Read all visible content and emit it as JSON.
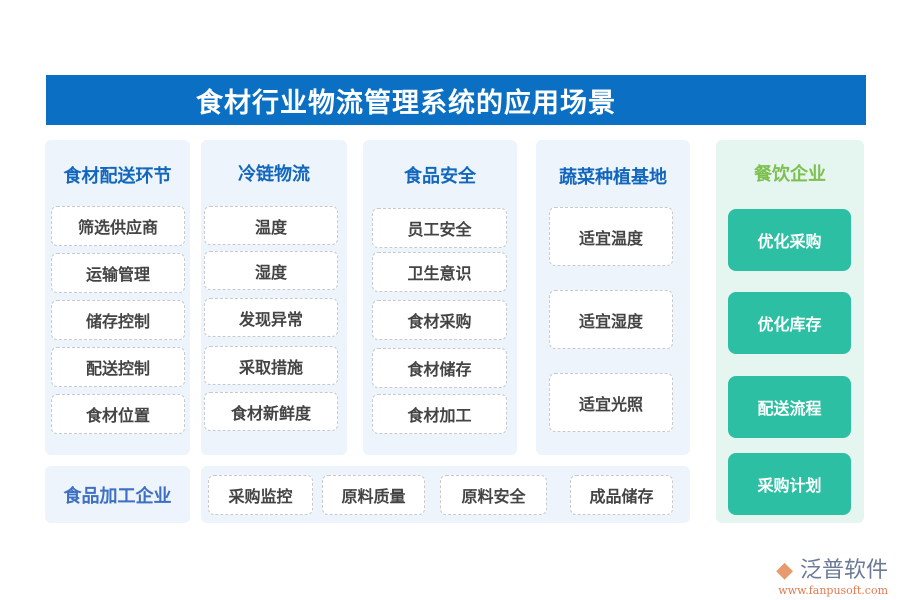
{
  "title": "食材行业物流管理系统的应用场景",
  "columns": [
    {
      "title": "食材配送环节",
      "items": [
        "筛选供应商",
        "运输管理",
        "储存控制",
        "配送控制",
        "食材位置"
      ]
    },
    {
      "title": "冷链物流",
      "items": [
        "温度",
        "湿度",
        "发现异常",
        "采取措施",
        "食材新鲜度"
      ]
    },
    {
      "title": "食品安全",
      "items": [
        "员工安全",
        "卫生意识",
        "食材采购",
        "食材储存",
        "食材加工"
      ]
    },
    {
      "title": "蔬菜种植基地",
      "items": [
        "适宜温度",
        "适宜湿度",
        "适宜光照"
      ]
    }
  ],
  "catering": {
    "title": "餐饮企业",
    "items": [
      "优化采购",
      "优化库存",
      "配送流程",
      "采购计划"
    ]
  },
  "processing": {
    "title": "食品加工企业",
    "items": [
      "采购监控",
      "原料质量",
      "原料安全",
      "成品储存"
    ]
  },
  "logo": {
    "name": "泛普软件",
    "url": "www.fanpusoft.com"
  },
  "colors": {
    "title_bar": "#0b6fc3",
    "panel": "#edf4fb",
    "teal": "#2dbfa3",
    "catering_title": "#7ec050"
  }
}
